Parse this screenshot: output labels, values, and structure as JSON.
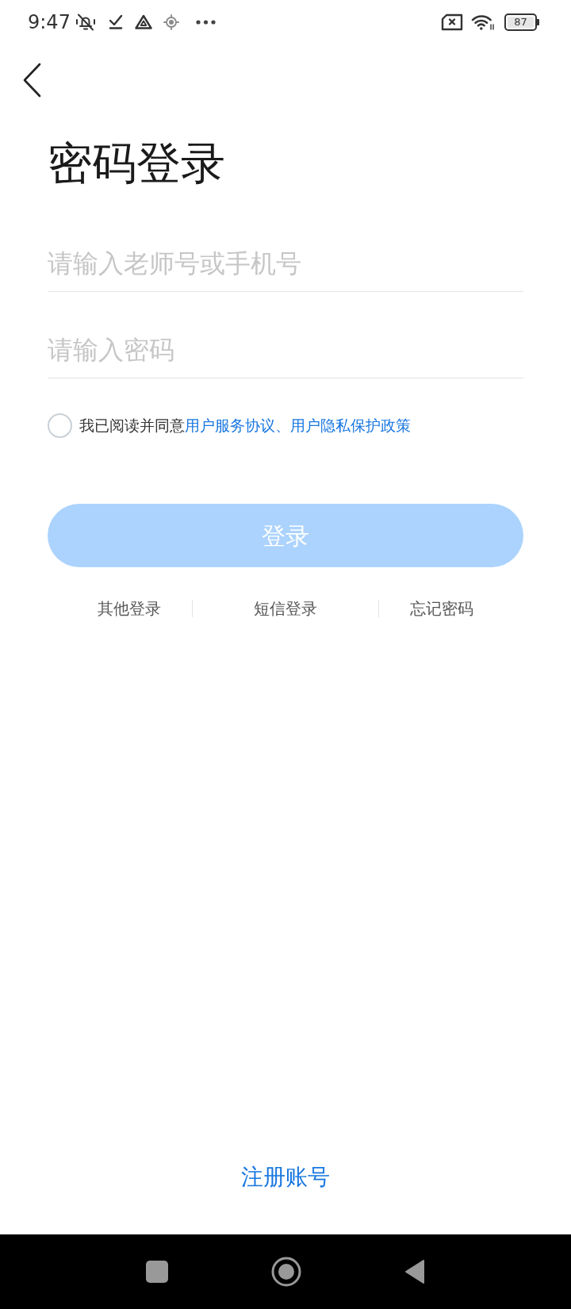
{
  "status_bar": {
    "time": "9:47",
    "battery": "87"
  },
  "title": "密码登录",
  "fields": [
    {
      "placeholder": "请输入老师号或手机号"
    },
    {
      "placeholder": "请输入密码"
    }
  ],
  "agreement": {
    "checked": false,
    "parts": [
      {
        "kind": "text",
        "text": "我已阅读并同意"
      },
      {
        "kind": "link",
        "text": "用户服务协议、用户隐私保护政策"
      }
    ]
  },
  "login_button": {
    "label": "登录",
    "disabled": true
  },
  "alt_links": [
    "其他登录",
    "短信登录",
    "忘记密码"
  ],
  "register_link": "注册账号"
}
